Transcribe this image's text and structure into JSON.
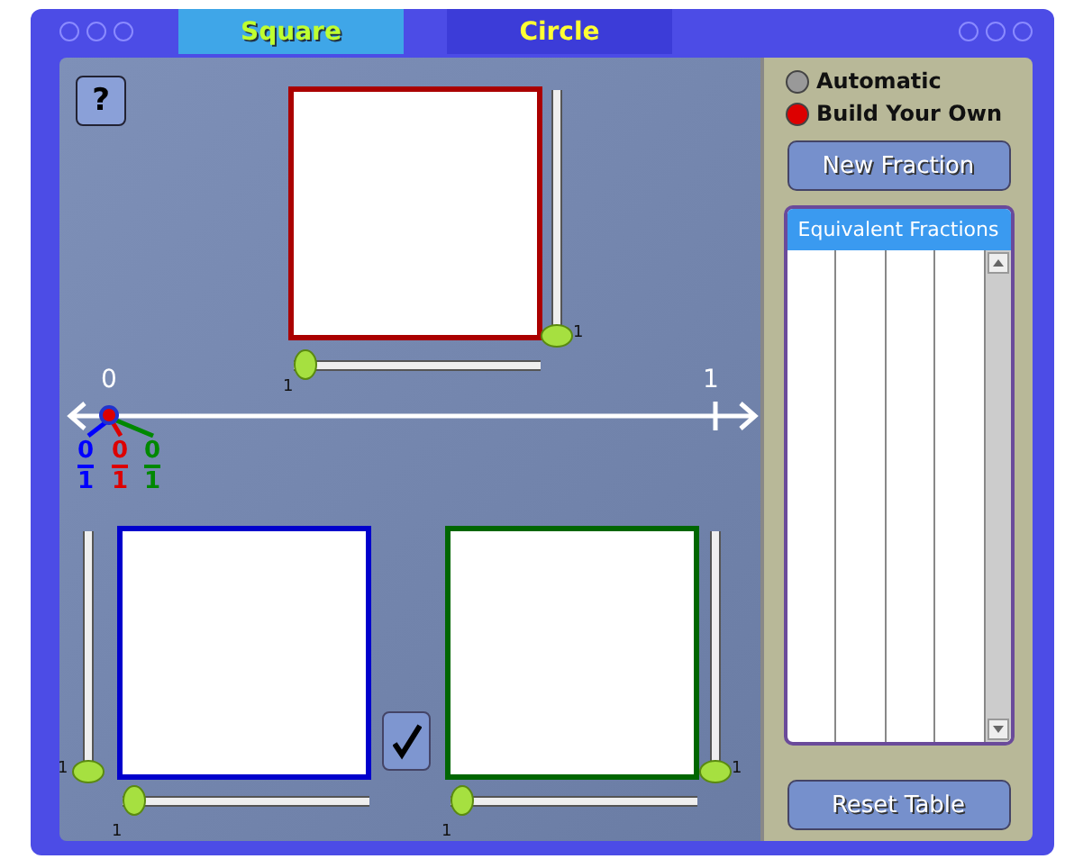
{
  "tabs": [
    {
      "label": "Square",
      "selected": true
    },
    {
      "label": "Circle",
      "selected": false
    }
  ],
  "modes": [
    {
      "label": "Automatic",
      "selected": false
    },
    {
      "label": "Build Your Own",
      "selected": true
    }
  ],
  "new_fraction_button": "New Fraction",
  "table": {
    "title": "Equivalent Fractions"
  },
  "reset_button": "Reset Table",
  "help_button": "?",
  "squares": [
    {
      "color": "#aa0000",
      "vertical_slider": {
        "level": 0,
        "reading": "1"
      },
      "horizontal_slider": {
        "level": 0,
        "reading": "1"
      }
    },
    {
      "color": "#0000cc",
      "vertical_slider": {
        "level": 0,
        "reading": "1"
      },
      "horizontal_slider": {
        "level": 0,
        "reading": "1"
      }
    },
    {
      "color": "#006600",
      "vertical_slider": {
        "level": 0,
        "reading": "1"
      },
      "horizontal_slider": {
        "level": 0,
        "reading": "1"
      }
    }
  ],
  "number_line": {
    "start_label": "0",
    "end_label": "1"
  },
  "fractions": [
    {
      "numerator": "0",
      "denominator": "1",
      "color": "#0000ff"
    },
    {
      "numerator": "0",
      "denominator": "1",
      "color": "#dd0000"
    },
    {
      "numerator": "0",
      "denominator": "1",
      "color": "#008800"
    }
  ]
}
